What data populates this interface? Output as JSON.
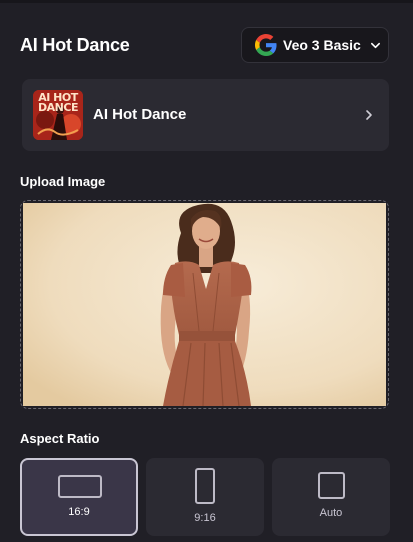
{
  "header": {
    "title": "AI Hot Dance",
    "model_selector": {
      "label": "Veo 3 Basic",
      "icon": "google-g-logo"
    }
  },
  "template_card": {
    "thumbnail_text": "AI HOT DANCE",
    "label": "AI Hot Dance",
    "icon": "chevron-right-icon"
  },
  "upload": {
    "label": "Upload Image",
    "content": "uploaded-photo"
  },
  "aspect_ratio": {
    "label": "Aspect Ratio",
    "options": [
      {
        "label": "16:9",
        "selected": true
      },
      {
        "label": "9:16",
        "selected": false
      },
      {
        "label": "Auto",
        "selected": false
      }
    ]
  },
  "colors": {
    "background": "#201f26",
    "card": "#2b2a32",
    "selected": "#3a3648",
    "accent_border": "#c9c6d3"
  }
}
